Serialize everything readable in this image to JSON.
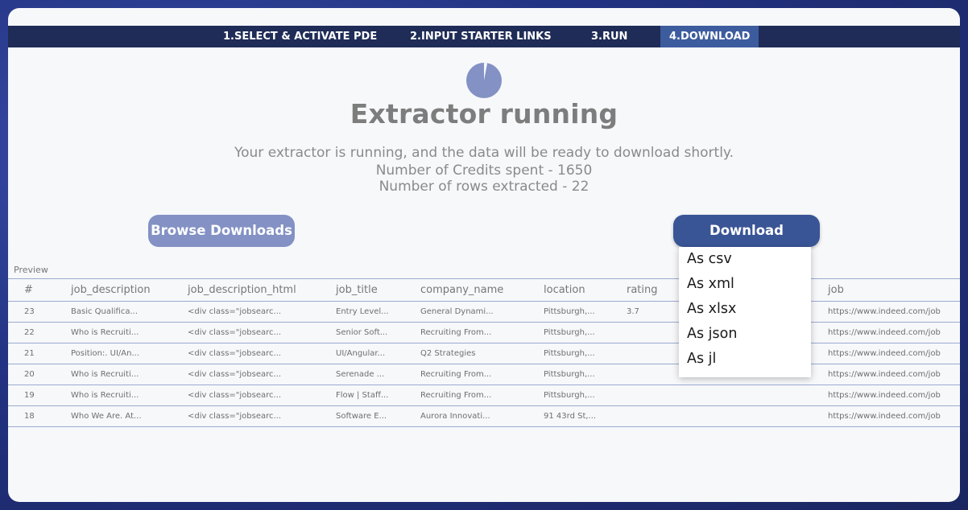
{
  "steps": [
    {
      "label": "1.SELECT & ACTIVATE PDE",
      "active": false
    },
    {
      "label": "2.INPUT STARTER LINKS",
      "active": false
    },
    {
      "label": "3.RUN",
      "active": false
    },
    {
      "label": "4.DOWNLOAD",
      "active": true
    }
  ],
  "status": {
    "title": "Extractor running",
    "message": "Your extractor is running, and the data will be ready to download shortly.",
    "credits": "Number of Credits spent - 1650",
    "rows": "Number of rows extracted - 22",
    "progress": 0.03
  },
  "buttons": {
    "browse": "Browse Downloads",
    "download": "Download"
  },
  "download_menu": [
    "As csv",
    "As xml",
    "As xlsx",
    "As json",
    "As jl"
  ],
  "preview": {
    "label": "Preview",
    "columns": [
      "#",
      "job_description",
      "job_description_html",
      "job_title",
      "company_name",
      "location",
      "rating",
      "",
      "job"
    ],
    "rows": [
      [
        "23",
        "Basic Qualifica...",
        "<div class=\"jobsearc...",
        "Entry Level...",
        "General Dynami...",
        "Pittsburgh,...",
        "3.7",
        "",
        "https://www.indeed.com/job"
      ],
      [
        "22",
        "Who is Recruiti...",
        "<div class=\"jobsearc...",
        "Senior Soft...",
        "Recruiting From...",
        "Pittsburgh,...",
        "",
        "",
        "https://www.indeed.com/job"
      ],
      [
        "21",
        "Position:. UI/An...",
        "<div class=\"jobsearc...",
        "UI/Angular...",
        "Q2 Strategies",
        "Pittsburgh,...",
        "",
        "",
        "https://www.indeed.com/job"
      ],
      [
        "20",
        "Who is Recruiti...",
        "<div class=\"jobsearc...",
        "Serenade ...",
        "Recruiting From...",
        "Pittsburgh,...",
        "",
        "",
        "https://www.indeed.com/job"
      ],
      [
        "19",
        "Who is Recruiti...",
        "<div class=\"jobsearc...",
        "Flow | Staff...",
        "Recruiting From...",
        "Pittsburgh,...",
        "",
        "",
        "https://www.indeed.com/job"
      ],
      [
        "18",
        "Who We Are. At...",
        "<div class=\"jobsearc...",
        "Software E...",
        "Aurora Innovati...",
        "91 43rd St,...",
        "",
        "",
        "https://www.indeed.com/job"
      ]
    ]
  },
  "colors": {
    "nav": "#1f2c57",
    "active_step": "#3d5c9e",
    "download_button": "#3a5596",
    "browse_button": "#8391c4",
    "spinner": "#8391c4"
  }
}
